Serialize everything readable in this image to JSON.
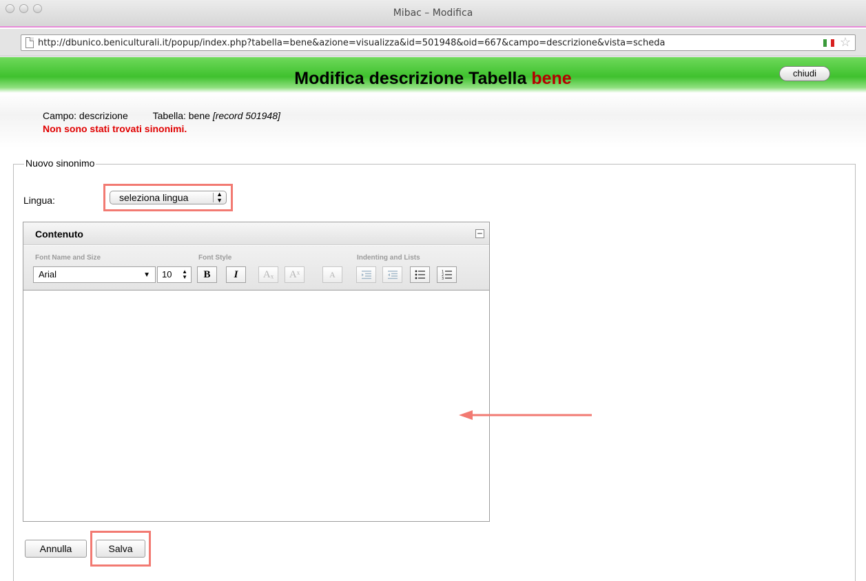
{
  "window": {
    "title": "Mibac – Modifica",
    "url": "http://dbunico.beniculturali.it/popup/index.php?tabella=bene&azione=visualizza&id=501948&oid=667&campo=descrizione&vista=scheda",
    "flag_colors": [
      "#3a9a3a",
      "#ffffff",
      "#d82020"
    ],
    "icons": [
      "page-icon",
      "flag-icon",
      "bookmark-star-icon"
    ]
  },
  "header": {
    "title_prefix": "Modifica descrizione Tabella",
    "title_table": "bene",
    "close_label": "chiudi",
    "accent_color": "#3fc12e",
    "table_color": "#b40000"
  },
  "info": {
    "campo": "Campo: descrizione",
    "tabella_label": "Tabella: bene",
    "record": "[record 501948]",
    "error": "Non sono stati trovati sinonimi."
  },
  "form": {
    "legend": "Nuovo sinonimo",
    "lingua_label": "Lingua:",
    "lingua_value": "seleziona lingua",
    "editor": {
      "title": "Contenuto",
      "groups": {
        "font": "Font Name and Size",
        "style": "Font Style",
        "indent": "Indenting and Lists"
      },
      "font_name": "Arial",
      "font_size": "10",
      "buttons": {
        "bold": "B",
        "italic": "I",
        "subscript": "Aₓ",
        "superscript": "Aˣ",
        "font_scale": "A"
      }
    },
    "cancel_label": "Annulla",
    "save_label": "Salva"
  },
  "annotations": {
    "highlight_color": "#f27a72"
  }
}
